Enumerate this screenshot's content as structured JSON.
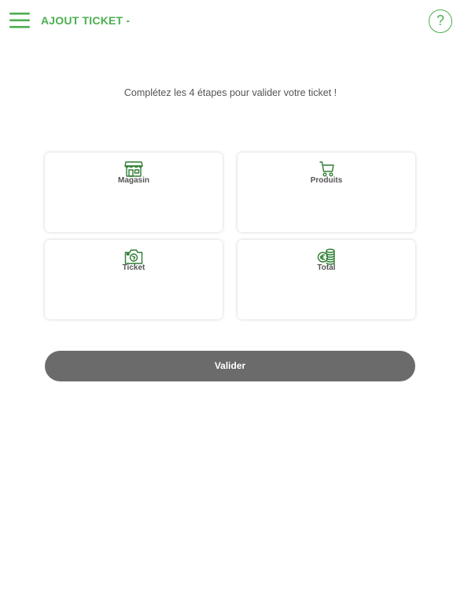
{
  "header": {
    "title": "AJOUT TICKET -",
    "menu_icon": "hamburger-menu-icon",
    "help_icon": "help-icon",
    "help_symbol": "?"
  },
  "instruction": "Complétez les 4 étapes pour valider votre ticket !",
  "steps": [
    {
      "label": "Magasin",
      "icon": "store-icon"
    },
    {
      "label": "Produits",
      "icon": "cart-icon"
    },
    {
      "label": "Ticket",
      "icon": "camera-icon"
    },
    {
      "label": "Total",
      "icon": "coins-icon"
    }
  ],
  "validate_label": "Valider",
  "colors": {
    "accent": "#4caf50",
    "button": "#6b6b6b",
    "text": "#555555"
  }
}
